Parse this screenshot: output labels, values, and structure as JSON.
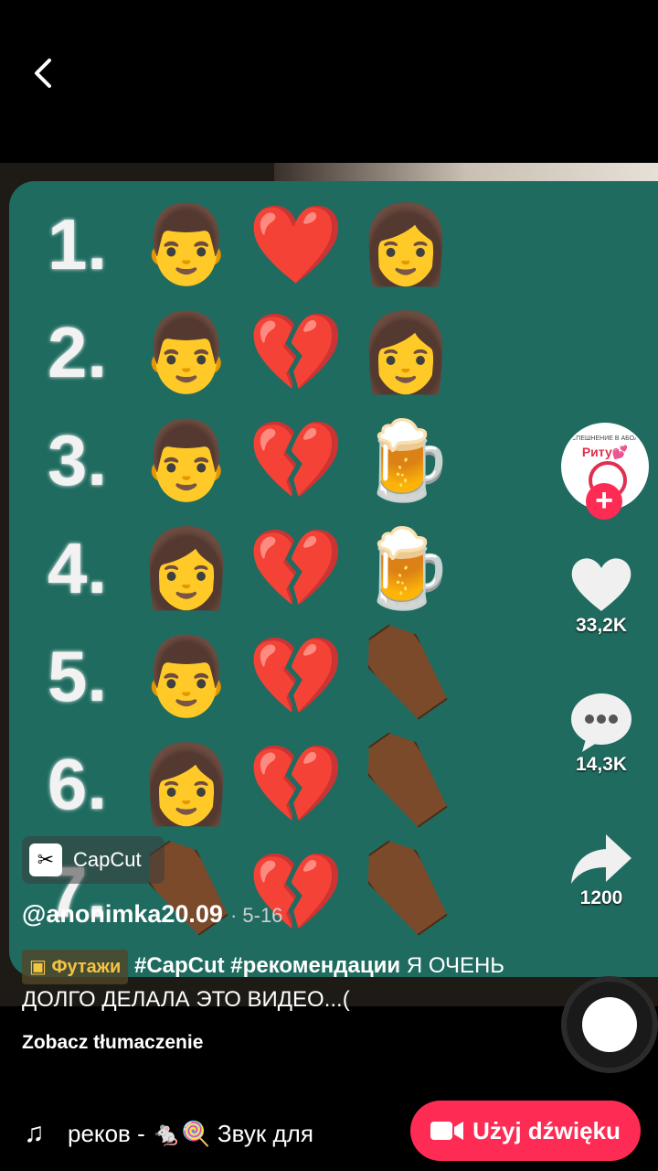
{
  "video_content": {
    "rows": [
      {
        "num": "1.",
        "emojis": [
          "👨",
          "❤️",
          "👩"
        ]
      },
      {
        "num": "2.",
        "emojis": [
          "👨",
          "💔",
          "👩"
        ]
      },
      {
        "num": "3.",
        "emojis": [
          "👨",
          "💔",
          "🍺"
        ]
      },
      {
        "num": "4.",
        "emojis": [
          "👩",
          "💔",
          "🍺"
        ]
      },
      {
        "num": "5.",
        "emojis": [
          "👨",
          "💔",
          "coffin"
        ]
      },
      {
        "num": "6.",
        "emojis": [
          "👩",
          "💔",
          "coffin"
        ]
      },
      {
        "num": "7.",
        "emojis": [
          "coffin",
          "💔",
          "coffin"
        ]
      }
    ]
  },
  "avatar": {
    "line1": "УСПЕШНЕНИЕ В АБОЛЬ",
    "line2": "Риту💕"
  },
  "actions": {
    "likes": "33,2K",
    "comments": "14,3K",
    "shares": "1200"
  },
  "capcut": {
    "label": "CapCut"
  },
  "post": {
    "author": "@anonimka20.09",
    "date": "· 5-16",
    "tag_label": "Футажи",
    "hashtags": "#CapCut #рекомендации",
    "text": "Я ОЧЕНЬ ДОЛГО ДЕЛАЛА ЭТО ВИДЕО...(",
    "translate": "Zobacz tłumaczenie"
  },
  "sound": {
    "text": "реков - 🐁🍭   Звук для"
  },
  "use_sound_button": {
    "label": "Użyj dźwięku"
  },
  "colors": {
    "accent": "#fe2c55",
    "board": "#1f6b5f"
  }
}
